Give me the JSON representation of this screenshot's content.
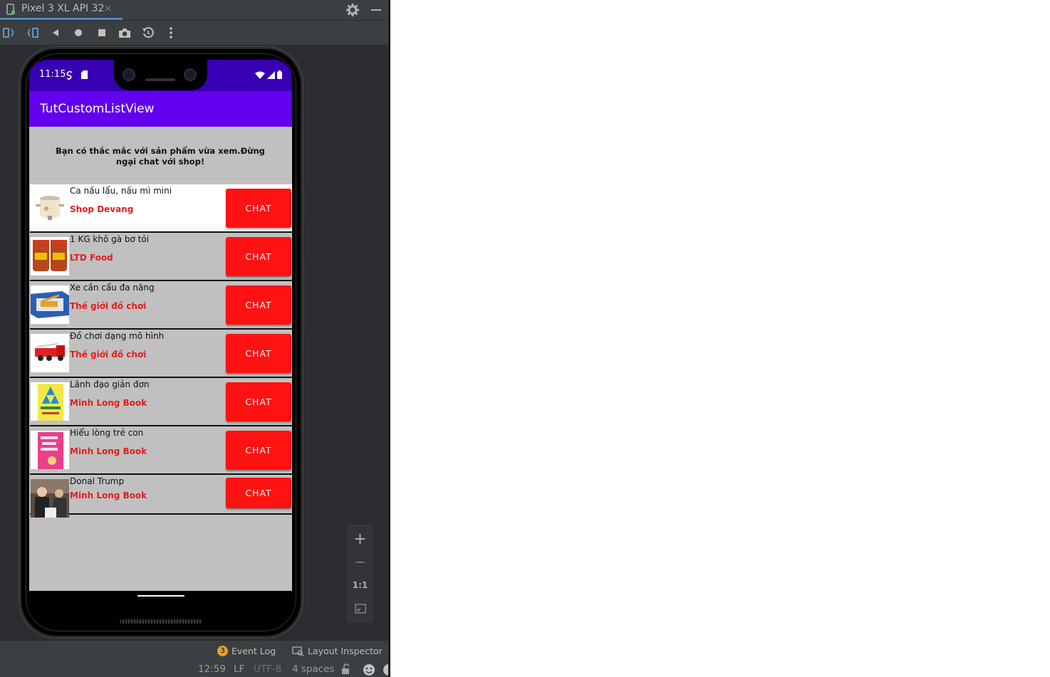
{
  "ide": {
    "tab_title": "Pixel 3 XL API 32",
    "tab_close": "×",
    "zoom": {
      "in": "+",
      "out": "−",
      "actual": "1:1"
    },
    "tool_windows": {
      "event_log_count": "3",
      "event_log": "Event Log",
      "layout_inspector": "Layout Inspector"
    },
    "statusbar": {
      "position": "12:59",
      "line_sep": "LF",
      "encoding": "UTF-8",
      "indent": "4 spaces"
    }
  },
  "phone": {
    "status_time": "11:15",
    "app_title": "TutCustomListView",
    "header": "Bạn có thắc mắc với sản phẩm vừa xem.Đừng ngại chat với shop!",
    "items": [
      {
        "name": "Ca nấu lẩu, nấu mì mini",
        "shop": "Shop Devang",
        "button": "CHAT",
        "thumb": "pot"
      },
      {
        "name": "1 KG khô gà bơ tỏi",
        "shop": "LTD Food",
        "button": "CHAT",
        "thumb": "jars"
      },
      {
        "name": "Xe cần cẩu đa năng",
        "shop": "Thế giới đồ chơi",
        "button": "CHAT",
        "thumb": "crane-box"
      },
      {
        "name": "Đồ chơi dạng mô hình",
        "shop": "Thế giới đồ chơi",
        "button": "CHAT",
        "thumb": "fire-truck"
      },
      {
        "name": "Lãnh đạo giản đơn",
        "shop": "Minh Long Book",
        "button": "CHAT",
        "thumb": "book-yellow"
      },
      {
        "name": "Hiểu lòng trẻ con",
        "shop": "Minh Long Book",
        "button": "CHAT",
        "thumb": "book-pink"
      },
      {
        "name": "Donal Trump",
        "shop": "Minh Long Book",
        "button": "CHAT",
        "thumb": "photo"
      }
    ]
  },
  "colors": {
    "status_bar": "#3700b3",
    "app_bar": "#6200ee",
    "chat_button": "#ff1212",
    "shop_text": "#e31e1e",
    "list_bg": "#c0c0c0"
  }
}
